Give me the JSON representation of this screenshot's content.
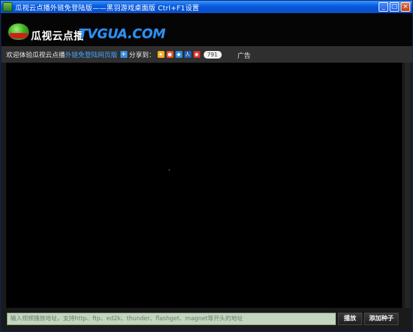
{
  "window": {
    "title": "瓜视云点播外链免登陆版——黑羽游戏桌面版 Ctrl+F1设置",
    "buttons": {
      "minimize": "_",
      "maximize": "□",
      "close": "×"
    }
  },
  "header": {
    "logo_cn": "瓜视云点播",
    "logo_en": "TVGUA.COM"
  },
  "infobar": {
    "welcome": "欢迎体验瓜视云点播",
    "free_link": "外链免登陆网页版",
    "share_label": "分享到：",
    "share_count": "791",
    "ad_label": "广告"
  },
  "controls": {
    "url_placeholder": "输入视频播放地址，支持http、ftp、ed2k、thunder、flashget、magnet等开头的地址",
    "play_label": "播放",
    "add_torrent_label": "添加种子"
  },
  "colors": {
    "titlebar": "#0553d8",
    "link": "#4aa6ff",
    "logo_en": "#2f8ff0",
    "input_bg": "#c3d6c0"
  }
}
